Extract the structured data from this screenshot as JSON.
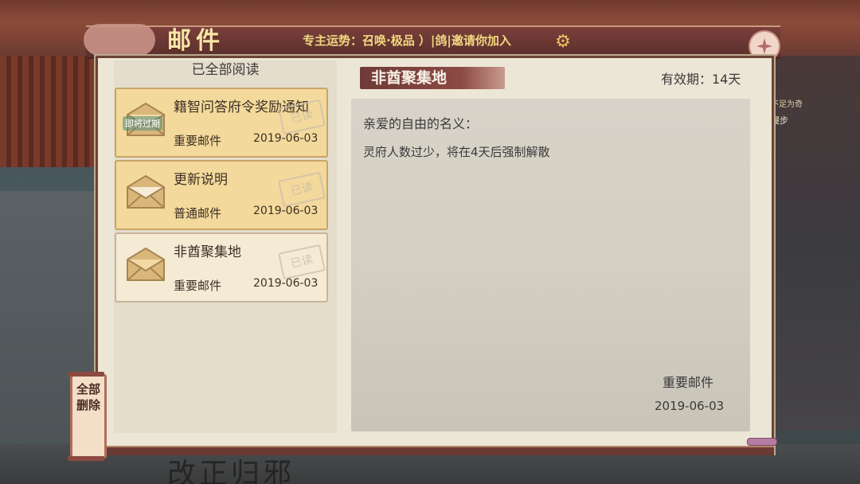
{
  "window": {
    "title": "邮件",
    "marquee": "专主运势：召唤·极品 ）|鸽|邀请你加入"
  },
  "mail_list": {
    "header": "已全部阅读",
    "items": [
      {
        "subject": "籍智问答府令奖励通知",
        "type": "重要邮件",
        "date": "2019-06-03",
        "badge": "即将过期",
        "stamp": "已读",
        "selected": true
      },
      {
        "subject": "更新说明",
        "type": "普通邮件",
        "date": "2019-06-03",
        "badge": "",
        "stamp": "已读",
        "selected": false
      },
      {
        "subject": "非酋聚集地",
        "type": "重要邮件",
        "date": "2019-06-03",
        "badge": "",
        "stamp": "已读",
        "selected": false
      }
    ]
  },
  "detail": {
    "title": "非酋聚集地",
    "validity": "有效期：14天",
    "greeting": "亲爱的自由的名义：",
    "body": "灵府人数过少，将在4天后强制解散",
    "signature_type": "重要邮件",
    "signature_date": "2019-06-03"
  },
  "actions": {
    "delete_all": "全部删除"
  },
  "background": {
    "banner_text": "改正归邪",
    "right_sign_1": "不足为奇",
    "right_sign_2": "漫步"
  },
  "colors": {
    "title_gold": "#f6e6a8",
    "banner_red": "#7a3f3a",
    "selected_item": "#f3d99b"
  }
}
